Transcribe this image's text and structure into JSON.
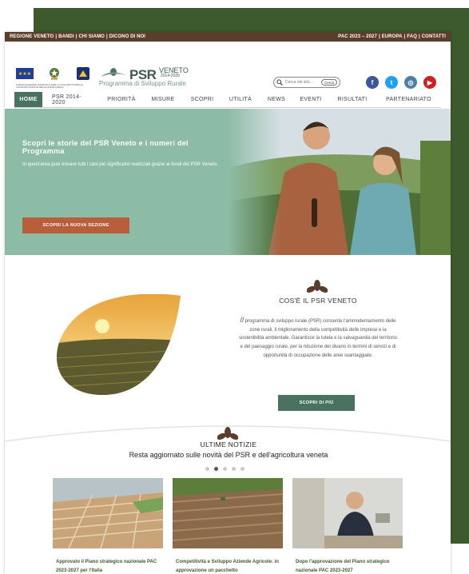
{
  "topbar": {
    "left_links": [
      "REGIONE VENETO",
      "BANDI",
      "CHI SIAMO",
      "DICONO DI NOI"
    ],
    "right_links": [
      "PAC 2023 – 2027",
      "EUROPA",
      "FAQ",
      "CONTATTI"
    ]
  },
  "header": {
    "logo_main": "PSR",
    "logo_region": "VENETO",
    "logo_years": "2014-2020",
    "logo_subtitle": "Programma di Sviluppo Rurale",
    "caption": "FONDO EUROPEO AGRICOLO PER LO SVILUPPO RURALE: L'EUROPA INVESTE NELLE ZONE RURALI",
    "search_placeholder": "Cerca nel sito...",
    "search_button": "Cerca",
    "social": [
      {
        "icon": "facebook-icon",
        "glyph": "f",
        "color": "#3b5998"
      },
      {
        "icon": "twitter-icon",
        "glyph": "t",
        "color": "#1da1f2"
      },
      {
        "icon": "instagram-icon",
        "glyph": "◎",
        "color": "#517fa4"
      },
      {
        "icon": "youtube-icon",
        "glyph": "▶",
        "color": "#cd201f"
      }
    ]
  },
  "nav": {
    "items": [
      "HOME",
      "PSR 2014-2020",
      "PRIORITÀ",
      "MISURE",
      "SCOPRI",
      "UTILITÀ",
      "NEWS",
      "EVENTI",
      "RISULTATI",
      "PARTENARIATO"
    ],
    "active_index": 0
  },
  "hero": {
    "title": "Scopri le storie del PSR Veneto e i numeri del Programma",
    "text": "In quest'area puoi trovare tutti i casi più significativi realizzati grazie ai fondi del PSR Veneto.",
    "button": "SCOPRI LA NUOVA SEZIONE"
  },
  "about": {
    "title": "COS'È IL PSR VENETO",
    "first_letter": "Il",
    "text": " programma di sviluppo rurale (PSR) consente l'ammodernamento delle zone rurali, il miglioramento della competitività delle imprese e la sostenibilità ambientale. Garantisce la tutela e la salvaguardia del territorio e del paesaggio rurale, per la riduzione del divario in termini di servizi e di opportunità di occupazione delle aree svantaggiate.",
    "button": "SCOPRI DI PIÙ"
  },
  "news": {
    "title": "ULTIME NOTIZIE",
    "subtitle": "Resta aggiornato sulle novità del PSR e dell'agricoltura veneta",
    "active_dot": 1,
    "dot_count": 5,
    "cards": [
      {
        "title": "Approvato il Piano strategico nazionale PAC 2023-2027 per l'Italia"
      },
      {
        "title": "Competitività e Sviluppo Aziende Agricole: in approvazione un pacchetto"
      },
      {
        "title": "Dopo l'approvazione del Piano strategico nazionale PAC 2023-2027"
      }
    ]
  },
  "colors": {
    "brand_green": "#4a7260",
    "topbar_brown": "#5a3e2b",
    "cta_orange": "#b85e3c",
    "frame_green": "#3c5a2c"
  }
}
